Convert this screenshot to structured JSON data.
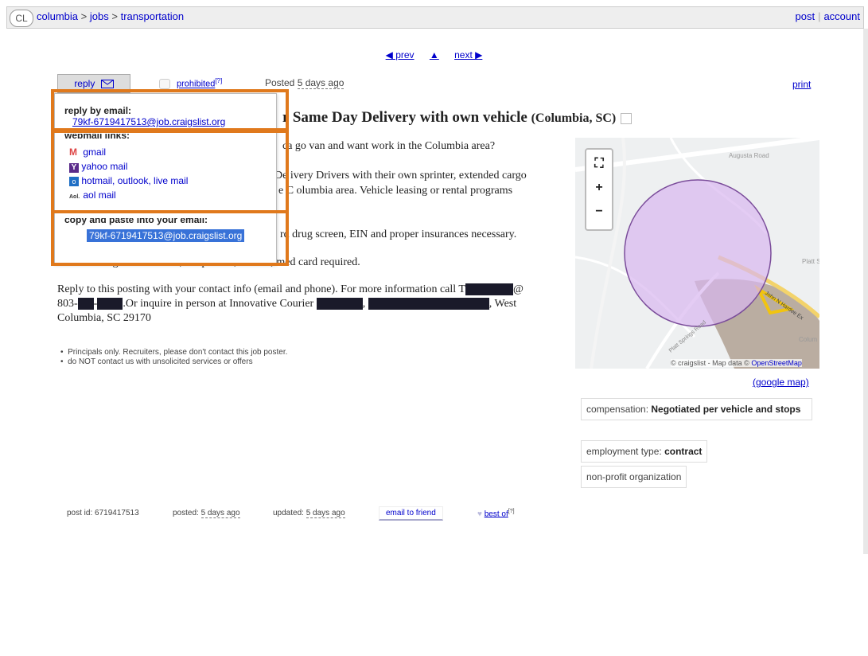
{
  "header": {
    "badge": "CL",
    "breadcrumb": [
      "columbia",
      "jobs",
      "transportation"
    ],
    "separator": ">",
    "post": "post",
    "account": "account"
  },
  "nav": {
    "prev": "◀ prev",
    "up": "▲",
    "next": "next ▶"
  },
  "toolbar": {
    "reply": "reply",
    "prohibited": "prohibited",
    "prohibited_sup": "[?]",
    "posted_prefix": "Posted",
    "posted_value": "5 days ago",
    "print": "print"
  },
  "dropdown": {
    "reply_by_email_label": "reply by email:",
    "reply_email": "79kf-6719417513@job.craigslist.org",
    "webmail_label": "webmail links:",
    "webmail": [
      {
        "icon": "gmail-icon",
        "label": "gmail"
      },
      {
        "icon": "yahoo-icon",
        "label": "yahoo mail"
      },
      {
        "icon": "outlook-icon",
        "label": "hotmail, outlook, live mail"
      },
      {
        "icon": "aol-icon",
        "label": "aol mail"
      }
    ],
    "copy_label": "copy and paste into your email:",
    "copy_email": "79kf-6719417513@job.craigslist.org"
  },
  "posting": {
    "title": "r Same Day Delivery with own vehicle",
    "location": "(Columbia, SC)",
    "p1": "ca go van and want work in the Columbia area?",
    "p2a": "De ivery Drivers with their own sprinter, extended cargo",
    "p2b": "e C olumbia area. Vehicle leasing or rental programs",
    "p3": "rd drug screen, EIN and proper insurances necessary.",
    "p4": "If vehicle is greater than 10,000 pounds, DOT #; med card required.",
    "p5a": "Reply to this posting with your contact info (email and phone). For more information call T",
    "p5a_end": "@",
    "p5b_start": "803-",
    "p5b_mid": "-",
    "p5b_rest": ".Or inquire in person at Innovative Courier",
    "p5b_comma": ",",
    "p5b_end": ", West",
    "p5c": "Columbia, SC 29170",
    "bullets": [
      "Principals only. Recruiters, please don't contact this job poster.",
      "do NOT contact us with unsolicited services or offers"
    ]
  },
  "map": {
    "labels": [
      "Augusta Road",
      "Platt Sp",
      "John N Hardee Ex",
      "Colum Metro",
      "Platt Springs Road"
    ],
    "attribution_prefix": "© craigslist - Map data ©",
    "attribution_link": "OpenStreetMap",
    "google_map": "(google map)"
  },
  "attributes": {
    "comp_label": "compensation:",
    "comp_value": "Negotiated per vehicle and stops",
    "emp_label": "employment type:",
    "emp_value": "contract",
    "nonprofit": "non-profit organization"
  },
  "footer": {
    "post_id": "post id: 6719417513",
    "posted_label": "posted:",
    "posted_value": "5 days ago",
    "updated_label": "updated:",
    "updated_value": "5 days ago",
    "email_friend": "email to friend",
    "best_of": "best of",
    "best_of_sup": "[?]"
  },
  "colors": {
    "highlight": "#e0791c",
    "link": "#0000cc",
    "map_circle": "#d9b6ef"
  }
}
